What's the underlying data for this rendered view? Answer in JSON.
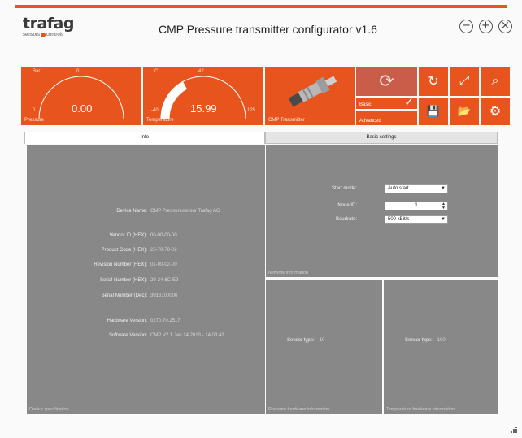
{
  "app": {
    "logo_word": "trafag",
    "logo_sub_left": "sensors",
    "logo_sub_right": "controls",
    "title": "CMP Pressure transmitter configurator v1.6"
  },
  "window_controls": {
    "minimize": "−",
    "maximize": "+",
    "close": "×"
  },
  "gauges": {
    "pressure": {
      "unit": "Bar",
      "min_label": "0",
      "mid_label": "0",
      "max_label": "1",
      "value": "0.00",
      "label": "Pressure",
      "level": 0.0
    },
    "temperature": {
      "unit": "C",
      "min_label": "-40",
      "mid_label": "42",
      "max_label": "125",
      "value": "15.99",
      "label": "Temperature",
      "level": 0.34
    }
  },
  "device_tile": {
    "label": "CMP Transmitter"
  },
  "mode": {
    "basic": "Basic",
    "advanced": "Advanced",
    "check": "✓"
  },
  "toolbar": {
    "sync": "⟳",
    "refresh": "↻",
    "expand": "⤢",
    "search": "⌕",
    "save": "💾",
    "open": "📂",
    "settings": "⚙"
  },
  "tabs": {
    "info": "Info",
    "basic_settings": "Basic settings"
  },
  "device_spec": {
    "caption": "Device specification",
    "device_name": {
      "label": "Device Name:",
      "value": "CMP Pressuresensor Trafag AG"
    },
    "vendor_id": {
      "label": "Vendor ID (HEX):",
      "value": "00-00-00-00"
    },
    "product_code": {
      "label": "Product Code (HEX):",
      "value": "25-70-70-02"
    },
    "revision_number": {
      "label": "Revision Number (HEX):",
      "value": "01-00-02-00"
    },
    "serial_hex": {
      "label": "Serial Number (HEX):",
      "value": "29-24-6C-E9"
    },
    "serial_dec": {
      "label": "Serial Number (Dec):",
      "value": "3916100006"
    },
    "hardware_version": {
      "label": "Hardware Version:",
      "value": "0270.70.2517"
    },
    "software_version": {
      "label": "Software Version:",
      "value": "CMP V2.1 Jan 14 2013 - 14:03:42"
    }
  },
  "network": {
    "caption": "Network information",
    "start_mode": {
      "label": "Start mode:",
      "value": "Auto start"
    },
    "node_id": {
      "label": "Node ID:",
      "value": "1"
    },
    "baudrate": {
      "label": "Baudrate:",
      "value": "500 kBit/s"
    }
  },
  "pressure_hw": {
    "caption": "Pressure hardware information",
    "sensor_type_label": "Sensor type:",
    "sensor_type_value": "10"
  },
  "temperature_hw": {
    "caption": "Temperature hardware information",
    "sensor_type_label": "Sensor type:",
    "sensor_type_value": "100"
  },
  "colors": {
    "accent": "#e8541e",
    "panel": "#888888",
    "sync_tile": "#c95d4a"
  }
}
